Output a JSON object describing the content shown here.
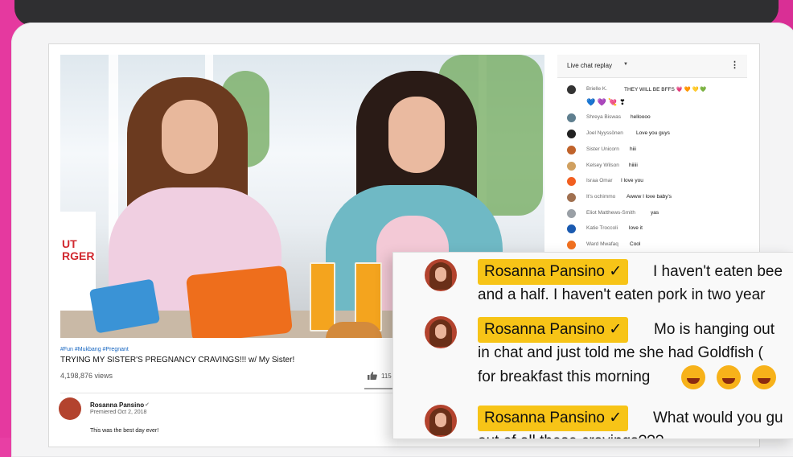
{
  "video": {
    "hashtags": "#Fun #Mukbang #Pregnant",
    "title": "TRYING MY SISTER'S PREGNANCY CRAVINGS!!! w/ My Sister!",
    "views": "4,198,876 views",
    "like_count": "115",
    "sign_text": "UT\nRGER"
  },
  "channel": {
    "name": "Rosanna Pansino",
    "verified_icon": "check-circle-icon",
    "premiered": "Premiered Oct 2, 2018",
    "description": "This was the best day ever!"
  },
  "chat": {
    "title": "Live chat replay",
    "dropdown_icon": "caret-down-icon",
    "more_icon": "more-vert-icon",
    "messages": [
      {
        "author": "Brielle K.",
        "text": "THEY WILL BE BFFS 💗 🧡 💛 💚",
        "extra": "💙 💜 💘 ❣",
        "avatar_color": "#333333"
      },
      {
        "author": "Shreya Biswas",
        "text": "helloooo",
        "avatar_color": "#5f7f8f"
      },
      {
        "author": "Joel Nyyssönen",
        "text": "Love you guys",
        "avatar_color": "#222222"
      },
      {
        "author": "Sister Unicorn",
        "text": "hiii",
        "avatar_color": "#c0632b"
      },
      {
        "author": "Kelsey Wilson",
        "text": "hiiiii",
        "avatar_color": "#d0a060"
      },
      {
        "author": "Israa Omar",
        "text": "I love you",
        "avatar_color": "#f25f20"
      },
      {
        "author": "It's ochimmo",
        "text": "Awww I love baby's",
        "avatar_color": "#a07050"
      },
      {
        "author": "Eliot Matthews-Smith",
        "text": "yas",
        "avatar_color": "#9aa0a6"
      },
      {
        "author": "Katie Troccoli",
        "text": "love it",
        "avatar_color": "#1a5ab0"
      },
      {
        "author": "Ward Mwafaq",
        "text": "Cool",
        "avatar_color": "#f07020"
      }
    ]
  },
  "overlay": {
    "messages": [
      {
        "author": "Rosanna Pansino ✓",
        "line1": "I haven't eaten bee",
        "line2": "and a half. I haven't eaten pork in two year"
      },
      {
        "author": "Rosanna Pansino ✓",
        "line1": "Mo is hanging out",
        "line2": "in chat and just told me she had Goldfish (",
        "line3": "for breakfast this morning"
      },
      {
        "author": "Rosanna Pansino ✓",
        "line1": "What would you gu",
        "line2": "out of all these cravings???"
      }
    ],
    "emoji_icon": "rofl-emoji-icon"
  }
}
